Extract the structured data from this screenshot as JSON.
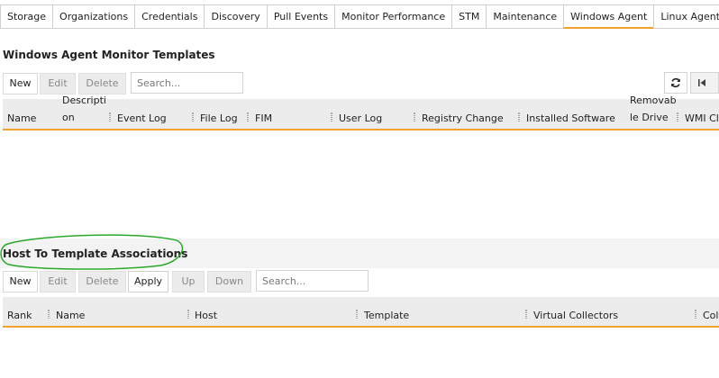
{
  "tabs": [
    {
      "label": "Storage"
    },
    {
      "label": "Organizations"
    },
    {
      "label": "Credentials"
    },
    {
      "label": "Discovery"
    },
    {
      "label": "Pull Events"
    },
    {
      "label": "Monitor Performance"
    },
    {
      "label": "STM"
    },
    {
      "label": "Maintenance"
    },
    {
      "label": "Windows Agent",
      "active": true
    },
    {
      "label": "Linux Agent"
    }
  ],
  "templates": {
    "title": "Windows Agent Monitor Templates",
    "new_label": "New",
    "edit_label": "Edit",
    "delete_label": "Delete",
    "search_placeholder": "Search...",
    "columns": {
      "name": "Name",
      "description_1": "Descripti",
      "description_2": "on",
      "event_log": "Event Log",
      "file_log": "File Log",
      "fim": "FIM",
      "user_log": "User Log",
      "registry_change": "Registry Change",
      "installed_software": "Installed Software",
      "removable_1": "Removab",
      "removable_2": "le Drive",
      "wmi": "WMI Cla"
    }
  },
  "associations": {
    "title": "Host To Template Associations",
    "new_label": "New",
    "edit_label": "Edit",
    "delete_label": "Delete",
    "apply_label": "Apply",
    "up_label": "Up",
    "down_label": "Down",
    "search_placeholder": "Search...",
    "columns": {
      "rank": "Rank",
      "name": "Name",
      "host": "Host",
      "template": "Template",
      "virtual_collectors": "Virtual Collectors",
      "col": "Col"
    }
  },
  "colors": {
    "accent": "#f0a030",
    "annotation": "#2aa82a",
    "header_bg": "#ececec"
  }
}
